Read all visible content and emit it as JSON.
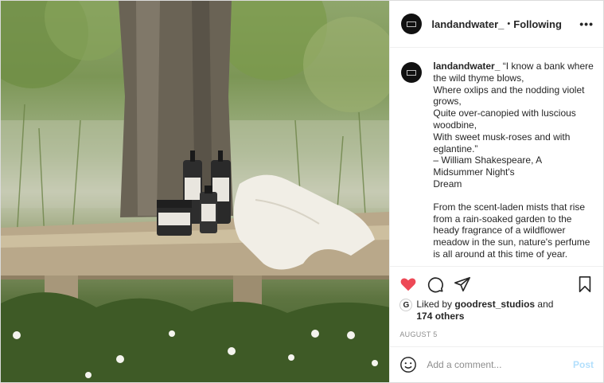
{
  "user": {
    "name": "landandwater_",
    "separator": "•",
    "follow_status": "Following"
  },
  "menu": {
    "more_label": "•••"
  },
  "caption": {
    "username": "landandwater_",
    "paragraph1": " “I know a bank where\nthe wild thyme blows,\nWhere oxlips and the nodding violet\ngrows,\nQuite over-canopied with luscious\nwoodbine,\nWith sweet musk-roses and with\neglantine.”\n– William Shakespeare, A\nMidsummer Night's\nDream",
    "paragraph2": "From the scent-laden mists that rise\nfrom a rain-soaked garden to the\nheady fragrance of a wildflower\nmeadow in the sun, nature's perfume\nis all around at this time of year."
  },
  "likes": {
    "avatar_letter": "G",
    "prefix": "Liked by ",
    "liker": "goodrest_studios",
    "conj": " and",
    "others": "174 others"
  },
  "date": "AUGUST 5",
  "comment": {
    "placeholder": "Add a comment...",
    "post_label": "Post"
  },
  "icons": [
    "heart-icon",
    "comment-icon",
    "share-icon",
    "bookmark-icon",
    "emoji-icon"
  ],
  "colors": {
    "like_red": "#ed4956",
    "post_disabled": "#b2dffc",
    "muted": "#8e8e8e"
  }
}
